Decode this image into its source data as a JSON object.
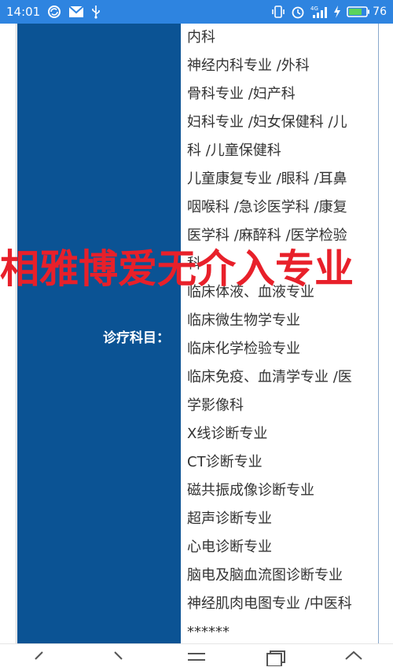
{
  "status_bar": {
    "time": "14:01",
    "battery_level": "76",
    "icons_left": [
      "sync-icon",
      "mail-icon",
      "usb-icon"
    ],
    "icons_right": [
      "vibrate-icon",
      "alarm-icon",
      "signal-4g-icon",
      "charging-icon",
      "battery-icon"
    ],
    "background_color": "#2e84e0"
  },
  "table": {
    "label": "诊疗科目：",
    "label_background_color": "#0b5394",
    "lines": [
      "内科",
      "神经内科专业 /外科",
      "骨科专业 /妇产科",
      "妇科专业 /妇女保健科 /儿",
      "科 /儿童保健科",
      "儿童康复专业 /眼科 /耳鼻",
      "咽喉科 /急诊医学科 /康复",
      "医学科 /麻醉科 /医学检验",
      "科",
      "临床体液、血液专业",
      "临床微生物学专业",
      "临床化学检验专业",
      "临床免疫、血清学专业 /医",
      "学影像科",
      "X线诊断专业",
      "CT诊断专业",
      "磁共振成像诊断专业",
      "超声诊断专业",
      "心电诊断专业",
      "脑电及脑血流图诊断专业",
      "神经肌肉电图专业 /中医科",
      "******"
    ]
  },
  "watermark": {
    "text": "相雅博爱无介入专业",
    "color": "#e8202a"
  },
  "nav_bar": {
    "buttons": [
      "back-icon",
      "forward-icon",
      "menu-icon",
      "tabs-icon",
      "home-icon"
    ]
  }
}
